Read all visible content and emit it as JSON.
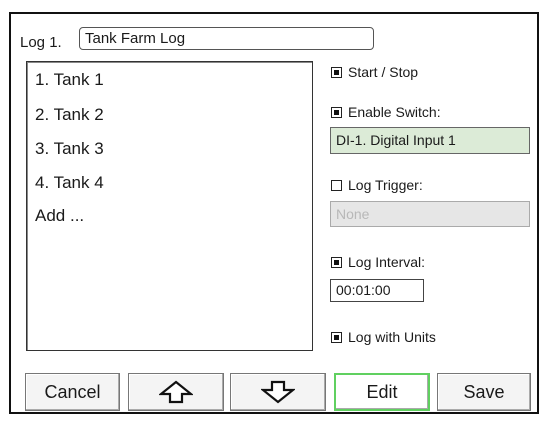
{
  "log": {
    "label": "Log 1.",
    "name": "Tank Farm Log"
  },
  "list": {
    "items": [
      "1. Tank 1",
      "2. Tank 2",
      "3. Tank 3",
      "4. Tank 4",
      "Add ..."
    ]
  },
  "options": {
    "start_stop": {
      "label": "Start / Stop",
      "checked": true
    },
    "enable_switch": {
      "label": "Enable Switch:",
      "checked": true,
      "value": "DI-1. Digital Input 1"
    },
    "log_trigger": {
      "label": "Log Trigger:",
      "checked": false,
      "value": "None"
    },
    "log_interval": {
      "label": "Log Interval:",
      "checked": true,
      "value": "00:01:00"
    },
    "log_with_units": {
      "label": "Log with Units",
      "checked": true
    }
  },
  "buttons": {
    "cancel": "Cancel",
    "up_icon": "up-arrow-icon",
    "down_icon": "down-arrow-icon",
    "edit": "Edit",
    "save": "Save"
  },
  "colors": {
    "enable_field_bg": "#dcebd7",
    "disabled_field_bg": "#e6e6e6",
    "edit_border": "#60d060"
  }
}
